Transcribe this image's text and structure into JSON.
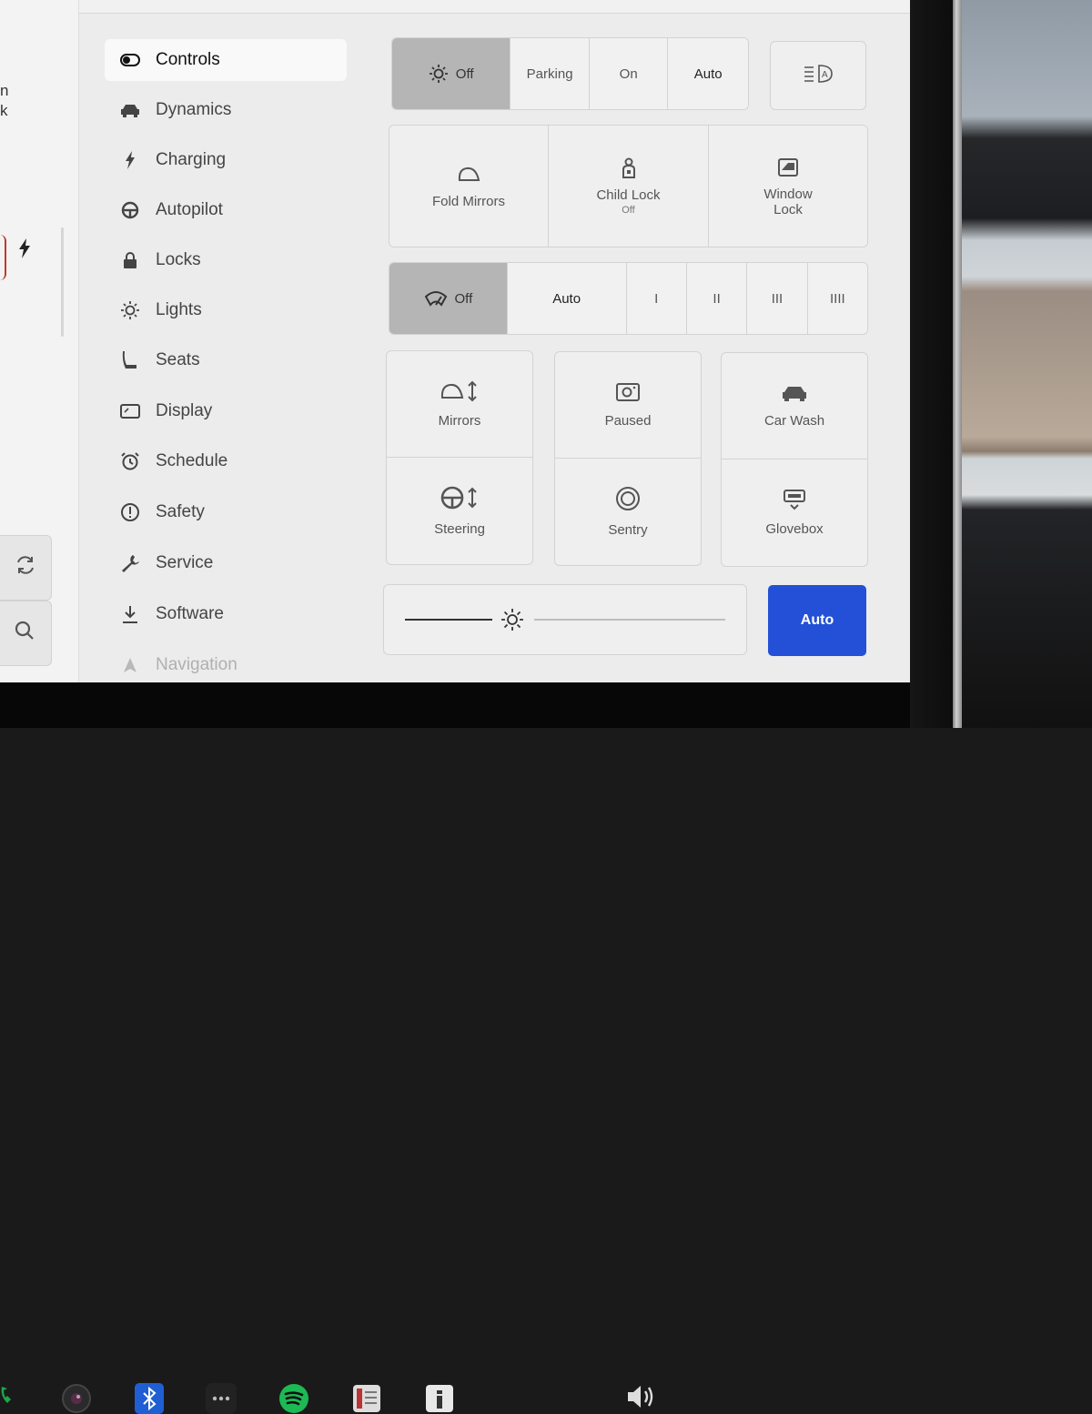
{
  "sidebar_fragments": {
    "line1": "n",
    "line2": "k"
  },
  "menu": {
    "items": [
      {
        "label": "Controls",
        "icon": "toggle-icon"
      },
      {
        "label": "Dynamics",
        "icon": "car-icon"
      },
      {
        "label": "Charging",
        "icon": "bolt-icon"
      },
      {
        "label": "Autopilot",
        "icon": "steering-wheel-icon"
      },
      {
        "label": "Locks",
        "icon": "lock-icon"
      },
      {
        "label": "Lights",
        "icon": "light-icon"
      },
      {
        "label": "Seats",
        "icon": "seat-icon"
      },
      {
        "label": "Display",
        "icon": "display-icon"
      },
      {
        "label": "Schedule",
        "icon": "alarm-clock-icon"
      },
      {
        "label": "Safety",
        "icon": "alert-icon"
      },
      {
        "label": "Service",
        "icon": "wrench-icon"
      },
      {
        "label": "Software",
        "icon": "download-icon"
      },
      {
        "label": "Navigation",
        "icon": "navigation-icon"
      }
    ],
    "active_index": 0
  },
  "lights": {
    "options": [
      "Off",
      "Parking",
      "On",
      "Auto"
    ],
    "selected": "Off"
  },
  "mirror_row": {
    "fold_mirrors": "Fold Mirrors",
    "child_lock": "Child Lock",
    "child_lock_status": "Off",
    "window_lock_line1": "Window",
    "window_lock_line2": "Lock"
  },
  "wipers": {
    "options": [
      "Off",
      "Auto",
      "I",
      "II",
      "III",
      "IIII"
    ],
    "selected": "Off"
  },
  "adjust": {
    "mirrors": "Mirrors",
    "steering": "Steering",
    "dashcam": "Paused",
    "sentry": "Sentry",
    "car_wash": "Car Wash",
    "glovebox": "Glovebox"
  },
  "brightness": {
    "level": 0.35,
    "auto_label": "Auto"
  },
  "colors": {
    "accent": "#2350d6",
    "selected_segment": "#b5b5b5",
    "spotify": "#1db954",
    "bluetooth": "#1f5fd3"
  }
}
